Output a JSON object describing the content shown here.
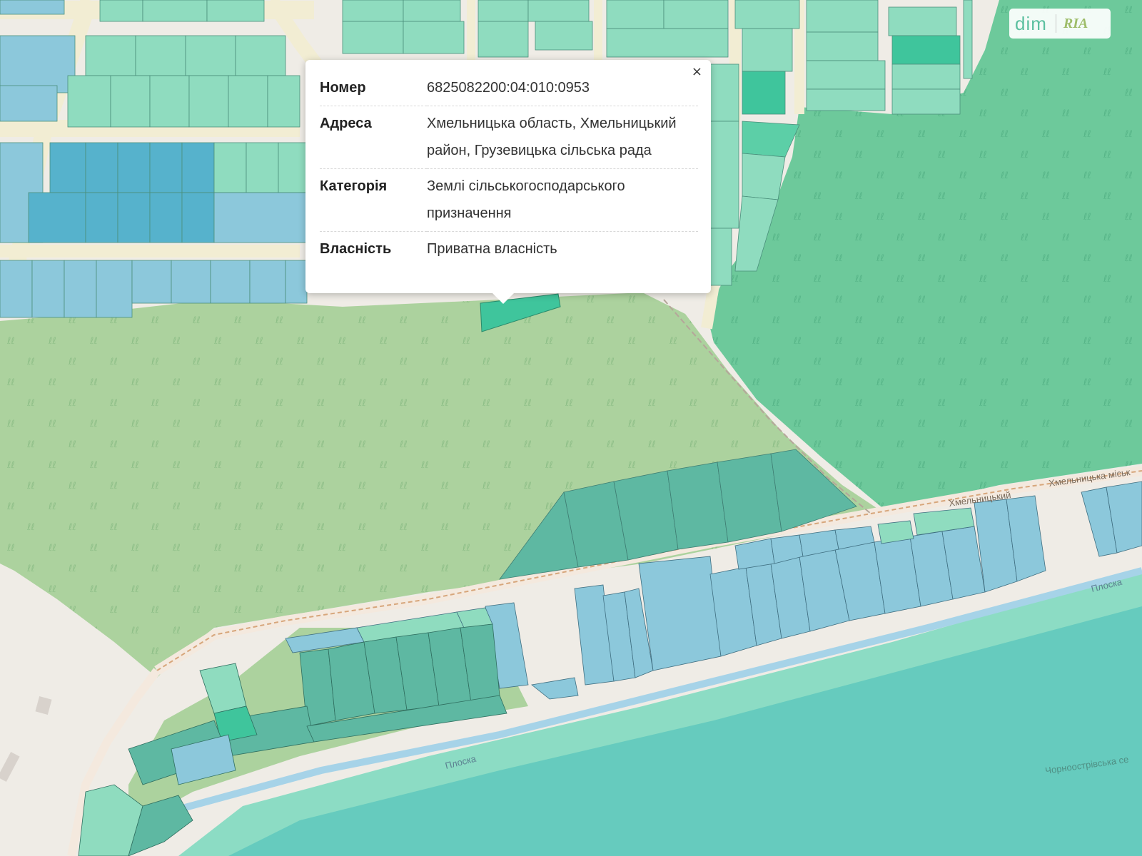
{
  "popup": {
    "close_label": "×",
    "rows": [
      {
        "key": "Номер",
        "value": "6825082200:04:010:0953"
      },
      {
        "key": "Адреса",
        "value": "Хмельницька область, Хмельницький район, Грузевицька сільська рада"
      },
      {
        "key": "Категорія",
        "value": "Землі сільськогосподарського призначення"
      },
      {
        "key": "Власність",
        "value": "Приватна власність"
      }
    ]
  },
  "logo": {
    "dim": "dim",
    "ria": "RIA"
  },
  "map_labels": {
    "road_top_1": "Хмельницький",
    "road_top_2": "Хмельницька міськ",
    "river_right": "Плоска",
    "river_left": "Плоска",
    "village": "Чорноострівська се"
  },
  "colors": {
    "plot_light": "#8fdcbf",
    "plot_blue": "#8cc8db",
    "plot_deep_blue": "#56b2cc",
    "forest_light": "#acd29e",
    "forest_dark": "#6dc99b",
    "water": "#66cbbe",
    "selected": "#3fc59c"
  }
}
